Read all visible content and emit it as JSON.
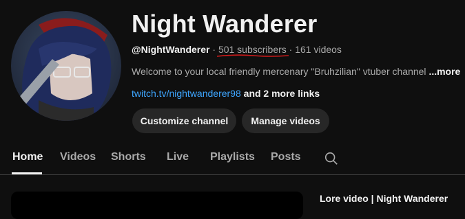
{
  "channel": {
    "name": "Night Wanderer",
    "handle": "@NightWanderer",
    "separator": "·",
    "subscribers": "501 subscribers",
    "videos": "161 videos",
    "description": "Welcome to your local friendly mercenary \"Bruhzilian\" vtuber channel",
    "description_more": "...more",
    "link": "twitch.tv/nightwanderer98",
    "more_links": "and 2 more links"
  },
  "buttons": {
    "customize": "Customize channel",
    "manage": "Manage videos"
  },
  "tabs": [
    {
      "label": "Home",
      "active": true
    },
    {
      "label": "Videos"
    },
    {
      "label": "Shorts"
    },
    {
      "label": "Live"
    },
    {
      "label": "Playlists"
    },
    {
      "label": "Posts"
    }
  ],
  "featured": {
    "title": "Lore video | Night Wanderer"
  },
  "icons": {
    "search": "search-icon",
    "avatar": "avatar"
  },
  "colors": {
    "background": "#0f0f0f",
    "link": "#3ea6ff",
    "underline_annotation": "#d11a1a",
    "button_bg": "#272727"
  }
}
